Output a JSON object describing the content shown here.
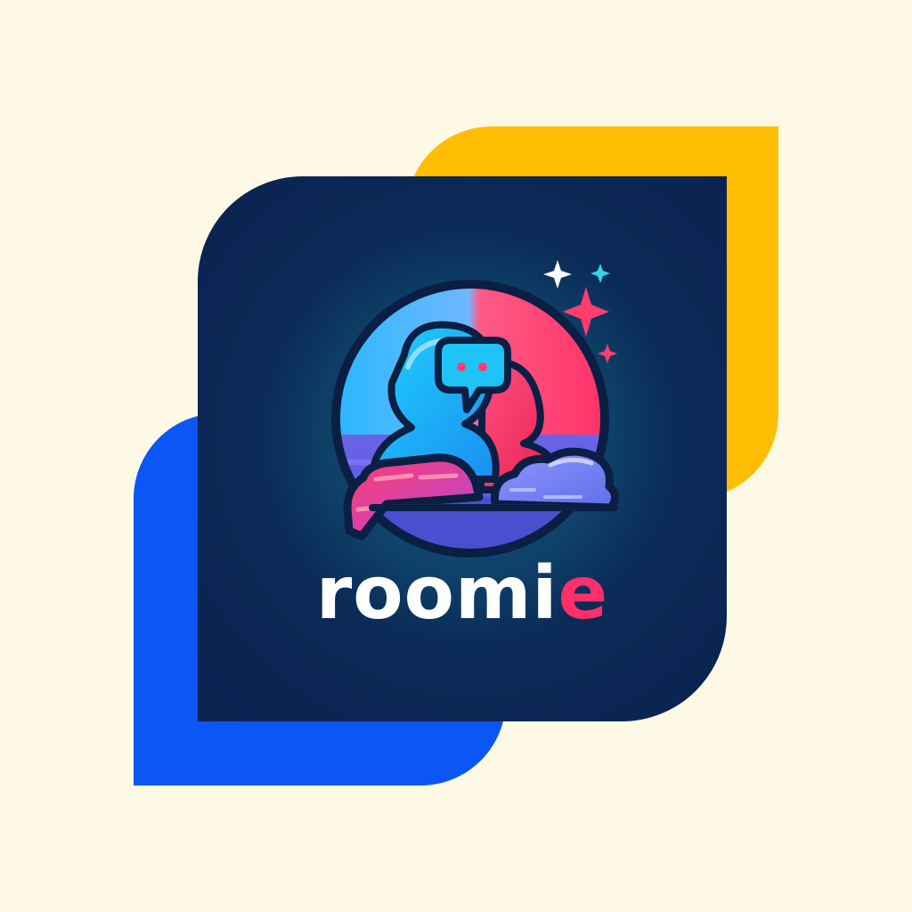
{
  "brand": {
    "name_part1": "roomi",
    "name_part2": "e",
    "colors": {
      "background": "#fef9e4",
      "yellow_shape": "#ffbd03",
      "blue_shape": "#0b56f5",
      "card": "#0b2150",
      "accent_pink": "#ff2f6b",
      "accent_cyan": "#19c6f5",
      "wordmark_white": "#ffffff"
    },
    "icons": [
      "chat-bubble-icon",
      "person-icon",
      "cloud-icon",
      "sparkle-icon"
    ]
  }
}
